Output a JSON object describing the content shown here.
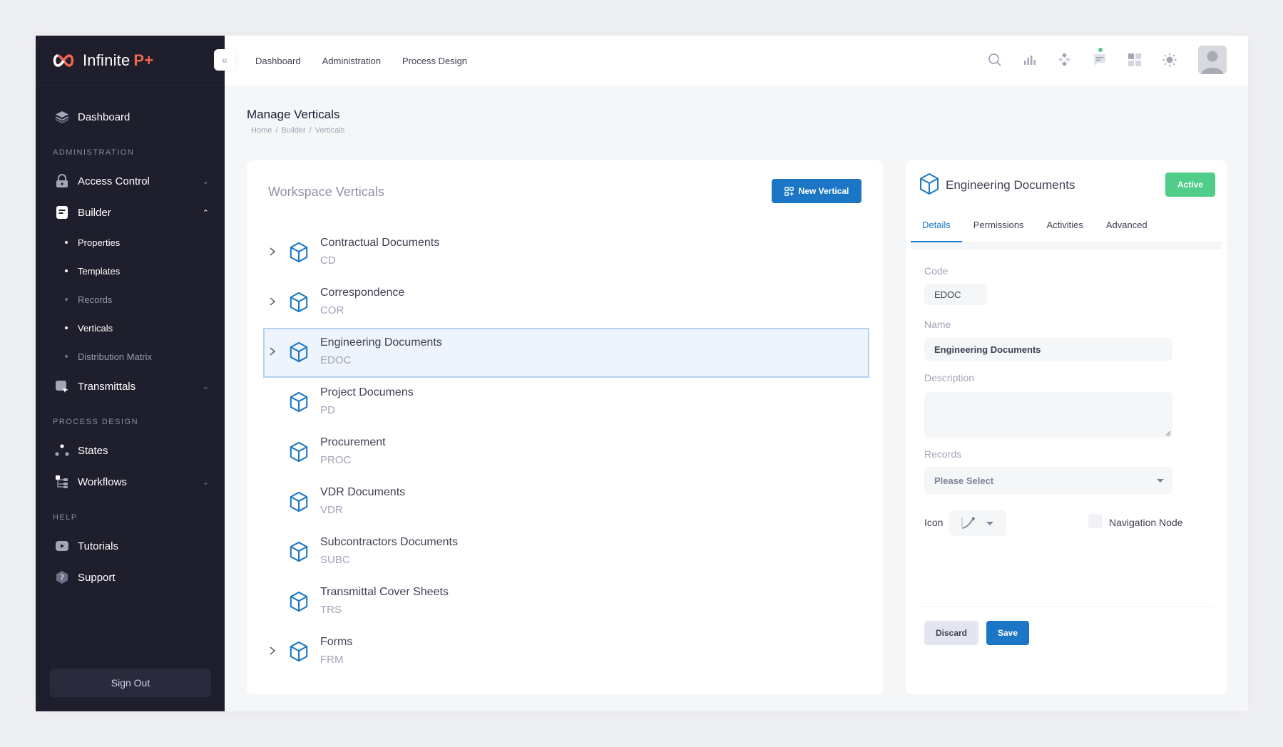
{
  "brand": {
    "name": "Infinite",
    "accent": "P+",
    "accent_color": "#f1664f"
  },
  "sidebar": {
    "dashboard": {
      "label": "Dashboard",
      "icon": "layers-icon"
    },
    "sections": {
      "administration": "ADMINISTRATION",
      "process_design": "PROCESS DESIGN",
      "help": "HELP"
    },
    "items": {
      "access_control": "Access Control",
      "builder": "Builder",
      "transmittals": "Transmittals",
      "states": "States",
      "workflows": "Workflows",
      "tutorials": "Tutorials",
      "support": "Support"
    },
    "builder_sub": [
      {
        "label": "Properties",
        "active": true
      },
      {
        "label": "Templates",
        "active": true
      },
      {
        "label": "Records",
        "active": false
      },
      {
        "label": "Verticals",
        "active": true
      },
      {
        "label": "Distribution Matrix",
        "active": false
      }
    ],
    "sign_out": "Sign Out"
  },
  "header": {
    "nav": [
      "Dashboard",
      "Administration",
      "Process Design"
    ],
    "icons": [
      "search-icon",
      "chart-icon",
      "grid-dots-icon",
      "chat-icon",
      "apps-icon",
      "sun-icon"
    ]
  },
  "page": {
    "title": "Manage Verticals",
    "breadcrumb": [
      "Home",
      "Builder",
      "Verticals"
    ]
  },
  "verticals_card": {
    "title": "Workspace Verticals",
    "new_button": "New Vertical",
    "items": [
      {
        "name": "Contractual Documents",
        "code": "CD",
        "expandable": true,
        "selected": false
      },
      {
        "name": "Correspondence",
        "code": "COR",
        "expandable": true,
        "selected": false
      },
      {
        "name": "Engineering Documents",
        "code": "EDOC",
        "expandable": true,
        "selected": true
      },
      {
        "name": "Project Documens",
        "code": "PD",
        "expandable": false,
        "selected": false
      },
      {
        "name": "Procurement",
        "code": "PROC",
        "expandable": false,
        "selected": false
      },
      {
        "name": "VDR Documents",
        "code": "VDR",
        "expandable": false,
        "selected": false
      },
      {
        "name": "Subcontractors Documents",
        "code": "SUBC",
        "expandable": false,
        "selected": false
      },
      {
        "name": "Transmittal Cover Sheets",
        "code": "TRS",
        "expandable": false,
        "selected": false
      },
      {
        "name": "Forms",
        "code": "FRM",
        "expandable": true,
        "selected": false
      }
    ]
  },
  "detail": {
    "title": "Engineering Documents",
    "status": "Active",
    "tabs": [
      "Details",
      "Permissions",
      "Activities",
      "Advanced"
    ],
    "active_tab": "Details",
    "code_label": "Code",
    "code_value": "EDOC",
    "name_label": "Name",
    "name_value": "Engineering Documents",
    "description_label": "Description",
    "description_value": "",
    "records_label": "Records",
    "records_placeholder": "Please Select",
    "icon_label": "Icon",
    "navigation_node_label": "Navigation Node",
    "navigation_node_checked": false,
    "discard": "Discard",
    "save": "Save"
  },
  "colors": {
    "primary": "#1b77c5",
    "success": "#50cd89",
    "sidebar": "#1e1e2d"
  }
}
